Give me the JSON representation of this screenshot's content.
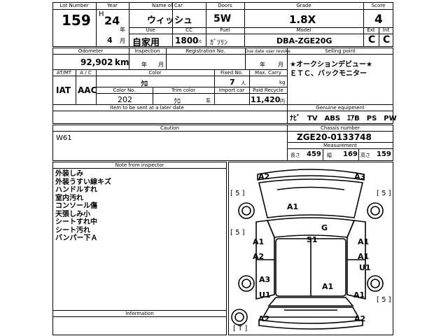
{
  "header": {
    "lot_number_label": "Lot Number",
    "lot_number": "159",
    "year_label": "Year",
    "year_era": "H",
    "year_value": "24",
    "year_unit": "年",
    "month_value": "4",
    "month_unit": "月",
    "name_label": "Name of Car",
    "name_value": "ウィッシュ",
    "doors_label": "Doors",
    "doors_value": "5W",
    "grade_label": "Grade",
    "grade_value": "1.8X",
    "score_label": "Score",
    "score_value": "4",
    "use_label": "Use",
    "use_value": "自家用",
    "cc_label": "CC",
    "cc_value": "1800",
    "cc_unit": "cc",
    "fuel_label": "Fuel",
    "fuel_value": "ｶﾞｿﾘﾝ",
    "model_label": "Model",
    "model_value": "DBA-ZGE20G",
    "ext_label": "Ext",
    "ext_value": "C",
    "int_label": "Int",
    "int_value": "C"
  },
  "info": {
    "odometer_label": "Odometer",
    "odometer_value": "92,902",
    "odometer_unit": "km",
    "inspection_label": "Inspection",
    "inspection_year_unit": "年",
    "inspection_month_unit": "月",
    "registration_label": "Registration No.",
    "due_label": "Due date user revoke",
    "due_year_unit": "年",
    "due_month_unit": "月",
    "selling_label": "Selling point",
    "selling_line1": "★オークションデビュー★",
    "selling_line2": "ＥＴＣ、バックモニター",
    "at_label": "AT/MT",
    "at_value": "IAT",
    "ac_label": "A / C",
    "ac_value": "AAC",
    "color_label": "Color",
    "color_value": "ｸﾛ",
    "fixed_label": "Fixed No.",
    "fixed_value": "7",
    "fixed_unit": "人",
    "carry_label": "Max. Carry",
    "carry_unit": "kg",
    "color_no_label": "Color No.",
    "color_no_value": "202",
    "trim_label": "Trim color",
    "trim_value": "ｸﾛ",
    "trim_unit": "系",
    "import_label": "Import car",
    "recycle_label": "Paid Recycle",
    "recycle_value": "11,420",
    "recycle_unit": "円",
    "later_label": "Item to be sent at a later date",
    "equipment_label": "Genuine equipment",
    "equipment_value": "ﾅﾋﾞ　TV　ABS　ｴｱB　PS　PW"
  },
  "caution": {
    "caution_label": "Caution",
    "caution_value": "W61",
    "chassis_label": "Chassis number",
    "chassis_value": "ZGE20-0133748",
    "measurement_label": "Measurement",
    "length_label": "長さ",
    "length_value": "459",
    "width_label": "幅",
    "width_value": "169",
    "height_label": "高さ",
    "height_value": "159"
  },
  "notes": {
    "label": "Note from inspector",
    "lines": [
      "外装しみ",
      "外装うすい線キズ",
      "ハンドルすれ",
      "室内汚れ",
      "コンソール傷",
      "天張しみ小",
      "シートすれ中",
      "シート汚れ",
      "バンパー下Ａ"
    ],
    "information_label": "Information"
  },
  "diagram": {
    "tire_label": "5",
    "tire_rl": "5",
    "tire_rr": "5",
    "tire_rear_right": "5",
    "spare_label": "T",
    "a2_front_left": "A2",
    "a3_front_right": "A3",
    "a1_hood": "A1",
    "g_windshield": "G",
    "s1_interior": "S1",
    "a1_left_front_door": "A1",
    "a1_right_front_door": "A1",
    "a2_left_rear_door": "A2",
    "a1_right_rear_door": "A1",
    "u1_right_rear_door": "U1",
    "a3_left_rear": "A3",
    "u1_left_rear": "U1",
    "a1_rear_gate": "A1",
    "a1_right_rear": "A1",
    "a2_rear_left": "A2",
    "a2_rear_right": "A2"
  }
}
